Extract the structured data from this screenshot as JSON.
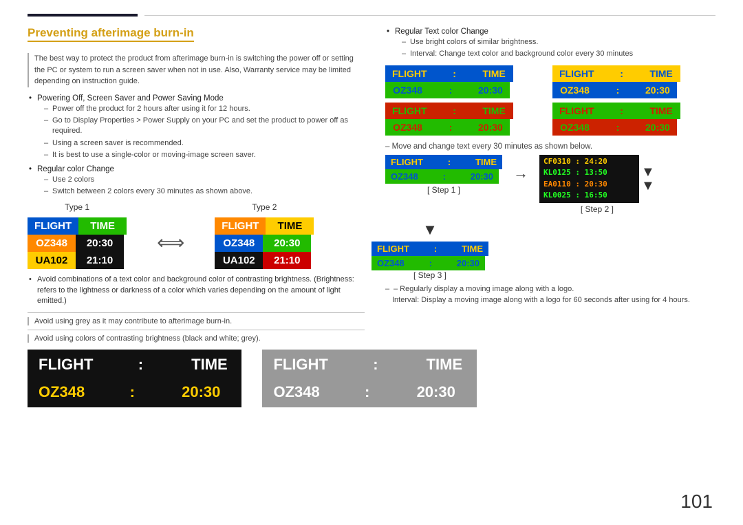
{
  "page": {
    "number": "101"
  },
  "header": {
    "title": "Preventing afterimage burn-in"
  },
  "left": {
    "intro": "The best way to protect the product from afterimage burn-in is switching the power off or setting the PC or system to run a screen saver when not in use. Also, Warranty service may be limited depending on instruction guide.",
    "bullets": [
      {
        "text": "Powering Off, Screen Saver and Power Saving Mode",
        "subs": [
          "Power off the product for 2 hours after using it for 12 hours.",
          "Go to Display Properties > Power Supply on your PC and set the product to power off as required.",
          "Using a screen saver is recommended.",
          "It is best to use a single-color or moving-image screen saver."
        ]
      },
      {
        "text": "Regular color Change",
        "subs": [
          "Use 2 colors",
          "Switch between 2 colors every 30 minutes as shown above."
        ]
      }
    ],
    "type1_label": "Type 1",
    "type2_label": "Type 2",
    "type1": {
      "row1": [
        {
          "text": "FLIGHT",
          "bg": "blue"
        },
        {
          "text": "TIME",
          "bg": "green"
        }
      ],
      "row2": [
        {
          "text": "OZ348",
          "bg": "orange"
        },
        {
          "text": "20:30",
          "bg": "black"
        }
      ],
      "row3": [
        {
          "text": "UA102",
          "bg": "yellow"
        },
        {
          "text": "21:10",
          "bg": "black"
        }
      ]
    },
    "type2": {
      "row1": [
        {
          "text": "FLIGHT",
          "bg": "orange"
        },
        {
          "text": "TIME",
          "bg": "yellow"
        }
      ],
      "row2": [
        {
          "text": "OZ348",
          "bg": "blue"
        },
        {
          "text": "20:30",
          "bg": "green"
        }
      ],
      "row3": [
        {
          "text": "UA102",
          "bg": "black"
        },
        {
          "text": "21:10",
          "bg": "red"
        }
      ]
    },
    "warn1": "Avoid combinations of a text color and background color of contrasting brightness. (Brightness: refers to the lightness or darkness of a color which varies depending on the amount of light emitted.)",
    "warn2": "Avoid using grey as it may contribute to afterimage burn-in.",
    "warn3": "Avoid using colors of contrasting brightness (black and white; grey).",
    "bottom_display1": {
      "row1": [
        {
          "text": "FLIGHT",
          "bg": "black"
        },
        {
          "text": ":",
          "bg": "black"
        },
        {
          "text": "TIME",
          "bg": "black"
        }
      ],
      "row2": [
        {
          "text": "OZ348",
          "bg": "black"
        },
        {
          "text": ":",
          "bg": "black"
        },
        {
          "text": "20:30",
          "bg": "black",
          "color": "yellow"
        }
      ]
    },
    "bottom_display2": {
      "row1": [
        {
          "text": "FLIGHT",
          "bg": "gray"
        },
        {
          "text": ":",
          "bg": "gray"
        },
        {
          "text": "TIME",
          "bg": "gray"
        }
      ],
      "row2": [
        {
          "text": "OZ348",
          "bg": "gray"
        },
        {
          "text": ":",
          "bg": "gray"
        },
        {
          "text": "20:30",
          "bg": "gray"
        }
      ]
    }
  },
  "right": {
    "bullet_text": "Regular Text color Change",
    "sub1": "Use bright colors of similar brightness.",
    "sub2": "Interval: Change text color and background color every 30 minutes",
    "color_grid": [
      {
        "row1": [
          {
            "text": "FLIGHT",
            "bg": "blue"
          },
          {
            "text": ":",
            "bg": "blue"
          },
          {
            "text": "TIME",
            "bg": "blue",
            "color": "yellow"
          }
        ],
        "row2": [
          {
            "text": "OZ348",
            "bg": "green"
          },
          {
            "text": ":",
            "bg": "green"
          },
          {
            "text": "20:30",
            "bg": "green",
            "color": "blue"
          }
        ]
      },
      {
        "row1": [
          {
            "text": "FLIGHT",
            "bg": "yellow"
          },
          {
            "text": ":",
            "bg": "yellow"
          },
          {
            "text": "TIME",
            "bg": "yellow",
            "color": "blue"
          }
        ],
        "row2": [
          {
            "text": "OZ348",
            "bg": "blue"
          },
          {
            "text": ":",
            "bg": "blue"
          },
          {
            "text": "20:30",
            "bg": "blue",
            "color": "yellow"
          }
        ]
      },
      {
        "row1": [
          {
            "text": "FLIGHT",
            "bg": "red"
          },
          {
            "text": ":",
            "bg": "red"
          },
          {
            "text": "TIME",
            "bg": "red",
            "color": "green"
          }
        ],
        "row2": [
          {
            "text": "OZ348",
            "bg": "green"
          },
          {
            "text": ":",
            "bg": "green"
          },
          {
            "text": "20:30",
            "bg": "green",
            "color": "red"
          }
        ]
      },
      {
        "row1": [
          {
            "text": "FLIGHT",
            "bg": "green"
          },
          {
            "text": ":",
            "bg": "green"
          },
          {
            "text": "TIME",
            "bg": "green",
            "color": "red"
          }
        ],
        "row2": [
          {
            "text": "OZ348",
            "bg": "red"
          },
          {
            "text": ":",
            "bg": "red"
          },
          {
            "text": "20:30",
            "bg": "red",
            "color": "green"
          }
        ]
      }
    ],
    "move_note": "– Move and change text every 30 minutes as shown below.",
    "step1_label": "[ Step 1 ]",
    "step2_label": "[ Step 2 ]",
    "step3_label": "[ Step 3 ]",
    "step1_display": {
      "row1": [
        {
          "text": "FLIGHT",
          "bg": "blue"
        },
        {
          "text": ":",
          "bg": "blue"
        },
        {
          "text": "TIME",
          "bg": "blue",
          "color": "yellow"
        }
      ],
      "row2": [
        {
          "text": "OZ348",
          "bg": "green"
        },
        {
          "text": ":",
          "bg": "green"
        },
        {
          "text": "20:30",
          "bg": "green",
          "color": "blue"
        }
      ]
    },
    "step2_scroll": [
      {
        "text": "CF0310 : 24:20",
        "color": "#ff0"
      },
      {
        "text": "KL0125 : 13:50",
        "color": "#0f0"
      },
      {
        "text": "EA0110 : 20:30",
        "color": "#f80"
      },
      {
        "text": "KL0025 : 16:50",
        "color": "#0f0"
      }
    ],
    "step3_display": {
      "row1": [
        {
          "text": "FLIGHT",
          "bg": "blue"
        },
        {
          "text": ":",
          "bg": "blue"
        },
        {
          "text": "TIME",
          "bg": "blue",
          "color": "yellow"
        }
      ],
      "row2": [
        {
          "text": "OZ348",
          "bg": "green"
        },
        {
          "text": ":",
          "bg": "green"
        },
        {
          "text": "20:30",
          "bg": "green",
          "color": "blue"
        }
      ]
    },
    "regularly_note": "– Regularly display a moving image along with a logo.",
    "regularly_sub": "Interval: Display a moving image along with a logo for 60 seconds after using for 4 hours."
  }
}
